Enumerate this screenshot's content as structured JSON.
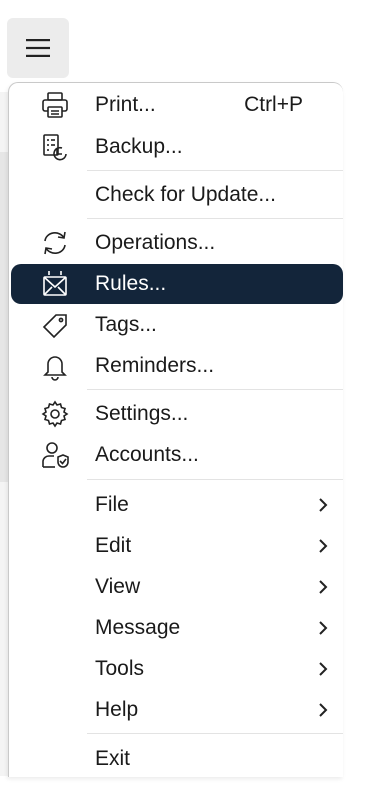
{
  "menu": {
    "items": [
      {
        "label": "Print...",
        "shortcut": "Ctrl+P"
      },
      {
        "label": "Backup..."
      },
      {
        "label": "Check for Update..."
      },
      {
        "label": "Operations..."
      },
      {
        "label": "Rules..."
      },
      {
        "label": "Tags..."
      },
      {
        "label": "Reminders..."
      },
      {
        "label": "Settings..."
      },
      {
        "label": "Accounts..."
      },
      {
        "label": "File"
      },
      {
        "label": "Edit"
      },
      {
        "label": "View"
      },
      {
        "label": "Message"
      },
      {
        "label": "Tools"
      },
      {
        "label": "Help"
      },
      {
        "label": "Exit"
      }
    ],
    "highlight_color": "#13253a",
    "icons": [
      "printer-icon",
      "backup-icon",
      "operations-icon",
      "rules-icon",
      "tag-icon",
      "bell-icon",
      "gear-icon",
      "account-icon",
      "chevron-right-icon"
    ]
  }
}
